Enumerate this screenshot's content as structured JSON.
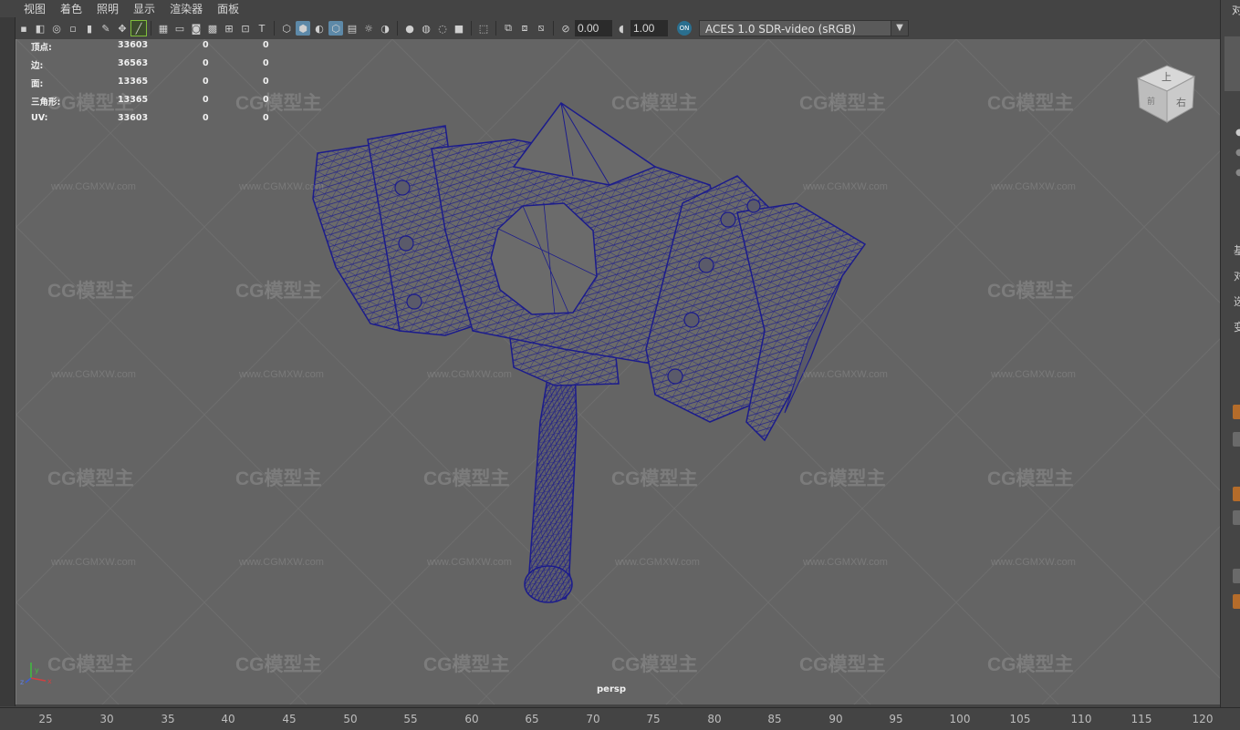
{
  "menu": [
    "视图",
    "着色",
    "照明",
    "显示",
    "渲染器",
    "面板"
  ],
  "toolbar": {
    "exposure": "0.00",
    "gamma": "1.00",
    "color_badge": "ON",
    "color_space": "ACES 1.0 SDR-video (sRGB)"
  },
  "hud": {
    "rows": [
      {
        "label": "顶点:",
        "values": [
          "33603",
          "0",
          "0"
        ]
      },
      {
        "label": "边:",
        "values": [
          "36563",
          "0",
          "0"
        ]
      },
      {
        "label": "面:",
        "values": [
          "13365",
          "0",
          "0"
        ]
      },
      {
        "label": "三角形:",
        "values": [
          "13365",
          "0",
          "0"
        ]
      },
      {
        "label": "UV:",
        "values": [
          "33603",
          "0",
          "0"
        ]
      }
    ]
  },
  "viewcube": {
    "top": "上",
    "right": "右",
    "front": "前"
  },
  "camera_label": "persp",
  "axis": {
    "x": "x",
    "y": "y",
    "z": "z"
  },
  "timeline": {
    "ticks": [
      "25",
      "30",
      "35",
      "40",
      "45",
      "50",
      "55",
      "60",
      "65",
      "70",
      "75",
      "80",
      "85",
      "90",
      "95",
      "100",
      "105",
      "110",
      "115",
      "120"
    ]
  },
  "right_panel": {
    "labels": [
      "对",
      "基",
      "对",
      "选",
      "变"
    ]
  },
  "watermark": {
    "brand": "CG模型主",
    "url": "www.CGMXW.com"
  },
  "colors": {
    "wire": "#1c1c8c",
    "mesh_fill": "#6a6a6a",
    "viewport_bg": "#646464",
    "accent": "#5d89a8"
  }
}
